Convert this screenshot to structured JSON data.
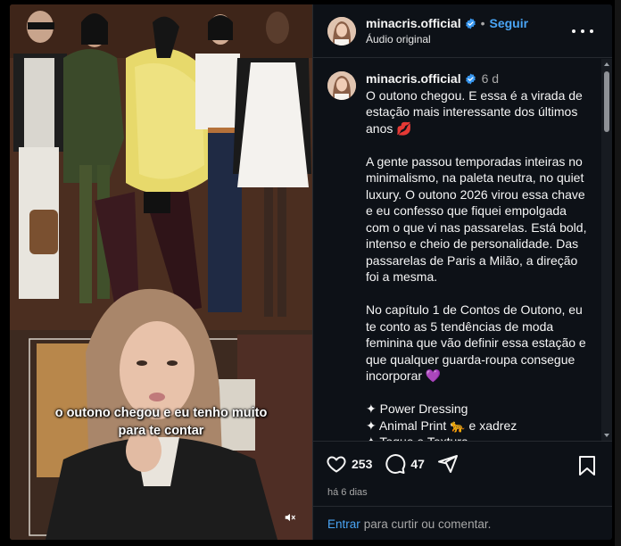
{
  "account": {
    "username": "minacris.official",
    "follow_label": "Seguir",
    "audio_label": "Áudio original",
    "separator": "•"
  },
  "video": {
    "caption_line1": "o outono chegou e eu tenho muito",
    "caption_line2": "para te contar"
  },
  "post": {
    "time": "6 d",
    "paragraphs": [
      "O outono chegou. E essa é a virada de estação mais interessante dos últimos anos 💋",
      "A gente passou temporadas inteiras no minimalismo, na paleta neutra, no quiet luxury. O outono 2026 virou essa chave e eu confesso que fiquei empolgada com o que vi nas passarelas. Está bold, intenso e cheio de personalidade. Das passarelas de Paris a Milão, a direção foi a mesma.",
      "No capítulo 1 de Contos de Outono, eu te conto as 5 tendências de moda feminina que vão definir essa estação e que qualquer guarda-roupa consegue incorporar 💜"
    ],
    "bullets": [
      "✦ Power Dressing",
      "✦ Animal Print 🐆 e xadrez",
      "✦ Toque e Textura"
    ]
  },
  "actions": {
    "likes": "253",
    "comments": "47",
    "date": "há 6 dias"
  },
  "footer": {
    "login_link": "Entrar",
    "rest": "para curtir ou comentar."
  },
  "icons": {
    "like": "heart-icon",
    "comment": "comment-icon",
    "share": "share-icon",
    "save": "bookmark-icon",
    "more": "more-options-icon",
    "verified": "verified-badge-icon",
    "mute": "muted-speaker-icon"
  },
  "colors": {
    "accent": "#4aa5f5",
    "verified": "#3897f0",
    "panel_bg": "#0d1117",
    "muted_text": "#a8a8a8"
  }
}
